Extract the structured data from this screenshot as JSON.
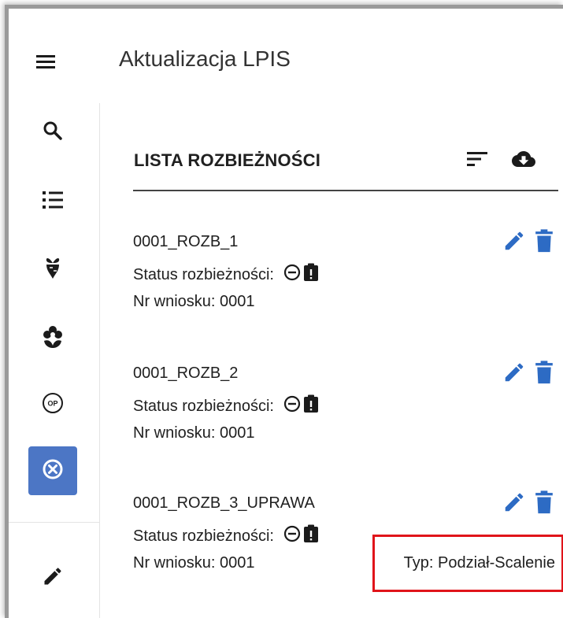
{
  "app": {
    "title": "Aktualizacja LPIS"
  },
  "sidebar": {
    "items": [
      {
        "icon": "search-icon"
      },
      {
        "icon": "list-icon"
      },
      {
        "icon": "beet-icon"
      },
      {
        "icon": "flower-icon"
      },
      {
        "icon": "op-badge-icon",
        "label": "OP"
      },
      {
        "icon": "close-circle-icon",
        "active": true
      },
      {
        "icon": "pencil-icon"
      }
    ],
    "active_color": "#4c76c5"
  },
  "list": {
    "header": "LISTA ROZBIEŻNOŚCI",
    "icons": [
      "sort-icon",
      "cloud-download-icon"
    ],
    "items": [
      {
        "name": "0001_ROZB_1",
        "status_label": "Status rozbieżności:",
        "nr_label": "Nr wniosku: 0001"
      },
      {
        "name": "0001_ROZB_2",
        "status_label": "Status rozbieżności:",
        "nr_label": "Nr wniosku: 0001"
      },
      {
        "name": "0001_ROZB_3_UPRAWA",
        "status_label": "Status rozbieżności:",
        "nr_label": "Nr wniosku: 0001",
        "type_label": "Typ: Podział-Scalenie"
      }
    ]
  },
  "colors": {
    "action_blue": "#2d6bc4",
    "highlight_red": "#e0141a"
  }
}
